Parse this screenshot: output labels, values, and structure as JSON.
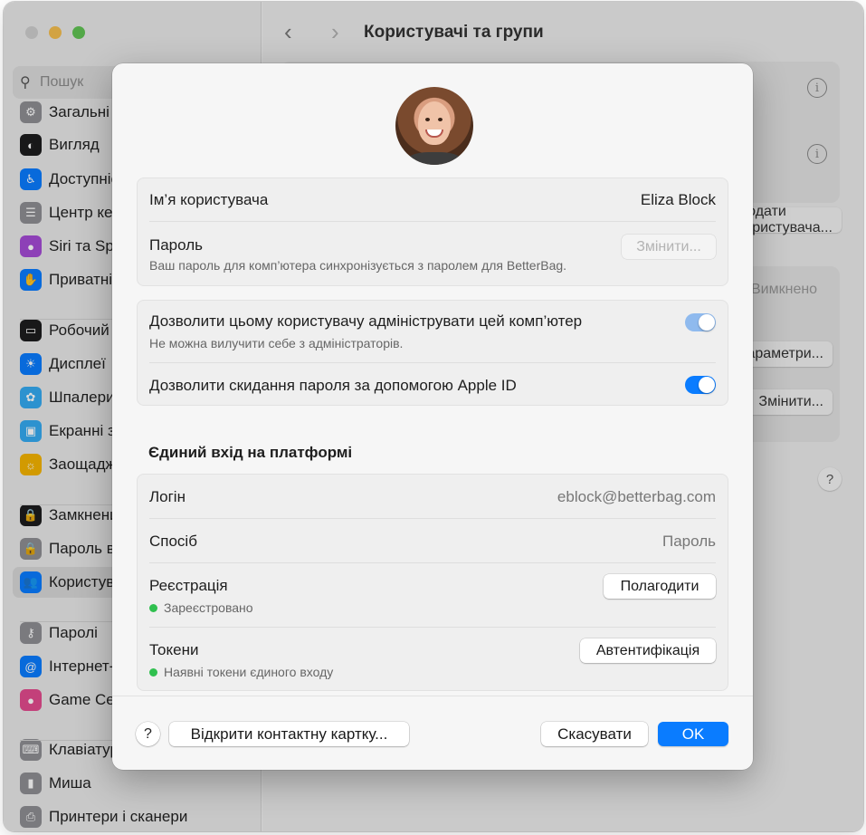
{
  "window": {
    "title": "Користувачі та групи",
    "search_placeholder": "Пошук"
  },
  "sidebar": {
    "items": [
      {
        "label": "Загальні",
        "icon": "gear-icon",
        "color": "#8e8e93"
      },
      {
        "label": "Вигляд",
        "icon": "appearance-icon",
        "color": "#1c1c1e"
      },
      {
        "label": "Доступність",
        "icon": "accessibility-icon",
        "color": "#0a7cff"
      },
      {
        "label": "Центр керування",
        "icon": "control-center-icon",
        "color": "#8e8e93"
      },
      {
        "label": "Siri та Spotlight",
        "icon": "siri-icon",
        "color": "#a54bd6"
      },
      {
        "label": "Приватність і безпека",
        "icon": "hand-icon",
        "color": "#0a7cff"
      },
      {
        "label": "Робочий стіл і Dock",
        "icon": "dock-icon",
        "color": "#1c1c1e"
      },
      {
        "label": "Дисплеї",
        "icon": "display-icon",
        "color": "#0a7cff"
      },
      {
        "label": "Шпалери",
        "icon": "wallpaper-icon",
        "color": "#35aaf2"
      },
      {
        "label": "Екранні заставки",
        "icon": "screensaver-icon",
        "color": "#35aaf2"
      },
      {
        "label": "Заощадження енергії",
        "icon": "bulb-icon",
        "color": "#f5b400"
      },
      {
        "label": "Замкнений екран",
        "icon": "lock-icon",
        "color": "#1c1c1e"
      },
      {
        "label": "Пароль входу",
        "icon": "lock-icon",
        "color": "#8e8e93"
      },
      {
        "label": "Користувачі та групи",
        "icon": "users-icon",
        "color": "#0a7cff"
      },
      {
        "label": "Паролі",
        "icon": "key-icon",
        "color": "#8e8e93"
      },
      {
        "label": "Інтернет-акаунти",
        "icon": "at-icon",
        "color": "#0a7cff"
      },
      {
        "label": "Game Center",
        "icon": "game-center-icon",
        "color": "#e34b8f"
      },
      {
        "label": "Клавіатура",
        "icon": "keyboard-icon",
        "color": "#8e8e93"
      },
      {
        "label": "Миша",
        "icon": "mouse-icon",
        "color": "#8e8e93"
      },
      {
        "label": "Принтери і сканери",
        "icon": "printer-icon",
        "color": "#8e8e93"
      }
    ]
  },
  "background": {
    "btn_users": "Додати користувача...",
    "select_value": "Вимкнено",
    "btn_params": "Параметри...",
    "btn_change": "Змінити..."
  },
  "sheet": {
    "username_label": "Ім’я користувача",
    "username_value": "Eliza Block",
    "password_label": "Пароль",
    "password_sub": "Ваш пароль для комп’ютера синхронізується з паролем для BetterBag.",
    "password_button": "Змінити...",
    "admin_label": "Дозволити цьому користувачу адмініструвати цей комп’ютер",
    "admin_sub": "Не можна вилучити себе з адміністраторів.",
    "reset_label": "Дозволити скидання пароля за допомогою Apple ID",
    "sso_title": "Єдиний вхід на платформі",
    "login_label": "Логін",
    "login_value": "eblock@betterbag.com",
    "method_label": "Спосіб",
    "method_value": "Пароль",
    "registration_label": "Реєстрація",
    "registration_status": "Зареєстровано",
    "registration_button": "Полагодити",
    "tokens_label": "Токени",
    "tokens_status": "Наявні токени єдиного входу",
    "tokens_button": "Автентифікація",
    "help_label": "?",
    "open_card_button": "Відкрити контактну картку...",
    "cancel_button": "Скасувати",
    "ok_button": "OK"
  },
  "colors": {
    "accent": "#0a7cff",
    "status_green": "#30c04f"
  }
}
